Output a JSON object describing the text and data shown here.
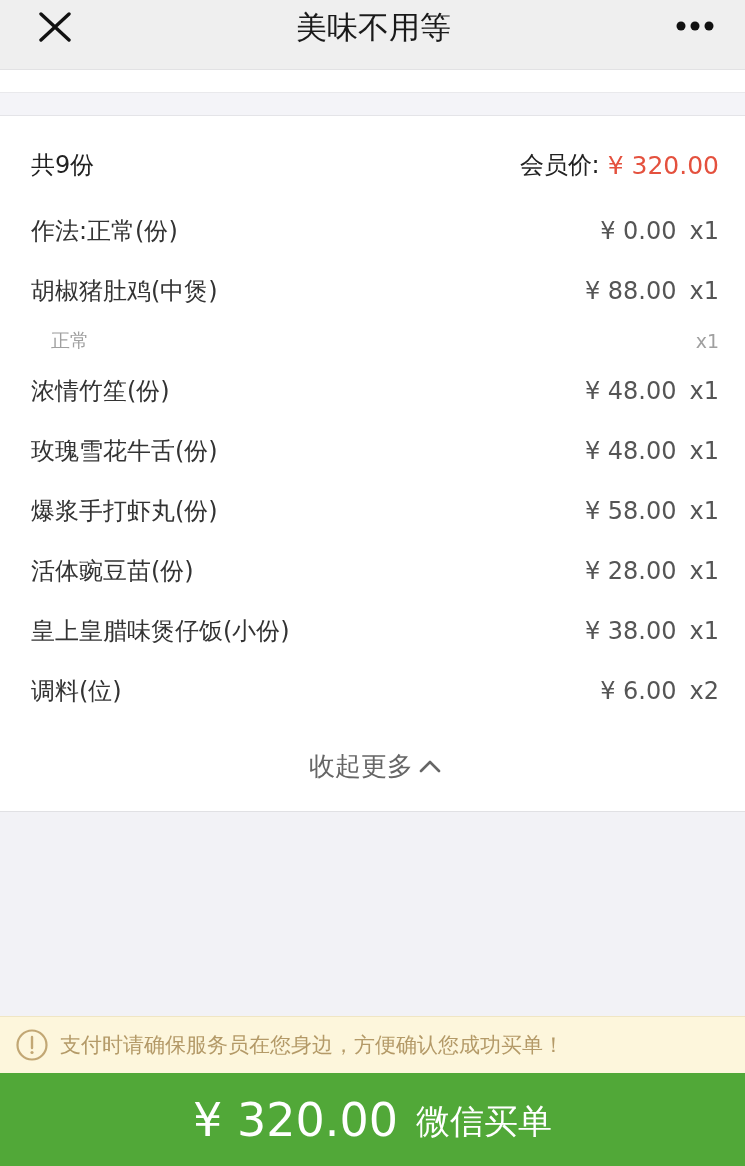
{
  "header": {
    "title": "美味不用等"
  },
  "order": {
    "count": "共9份",
    "member_price_label": "会员价:",
    "member_price": "¥ 320.00",
    "items": [
      {
        "name": "作法:正常(份)",
        "price": "¥ 0.00",
        "quantity": "x1"
      },
      {
        "name": "胡椒猪肚鸡(中煲)",
        "price": "¥ 88.00",
        "quantity": "x1",
        "options": [
          {
            "name": "正常",
            "quantity": "x1"
          }
        ]
      },
      {
        "name": "浓情竹笙(份)",
        "price": "¥ 48.00",
        "quantity": "x1"
      },
      {
        "name": "玫瑰雪花牛舌(份)",
        "price": "¥ 48.00",
        "quantity": "x1"
      },
      {
        "name": "爆浆手打虾丸(份)",
        "price": "¥ 58.00",
        "quantity": "x1"
      },
      {
        "name": "活体豌豆苗(份)",
        "price": "¥ 28.00",
        "quantity": "x1"
      },
      {
        "name": "皇上皇腊味煲仔饭(小份)",
        "price": "¥ 38.00",
        "quantity": "x1"
      },
      {
        "name": "调料(位)",
        "price": "¥ 6.00",
        "quantity": "x2"
      }
    ],
    "toggle": {
      "label": "收起更多",
      "expanded": true
    }
  },
  "notice": {
    "text": "支付时请确保服务员在您身边，方便确认您成功买单！"
  },
  "pay_button": {
    "amount": "¥ 320.00",
    "label": "微信买单"
  }
}
